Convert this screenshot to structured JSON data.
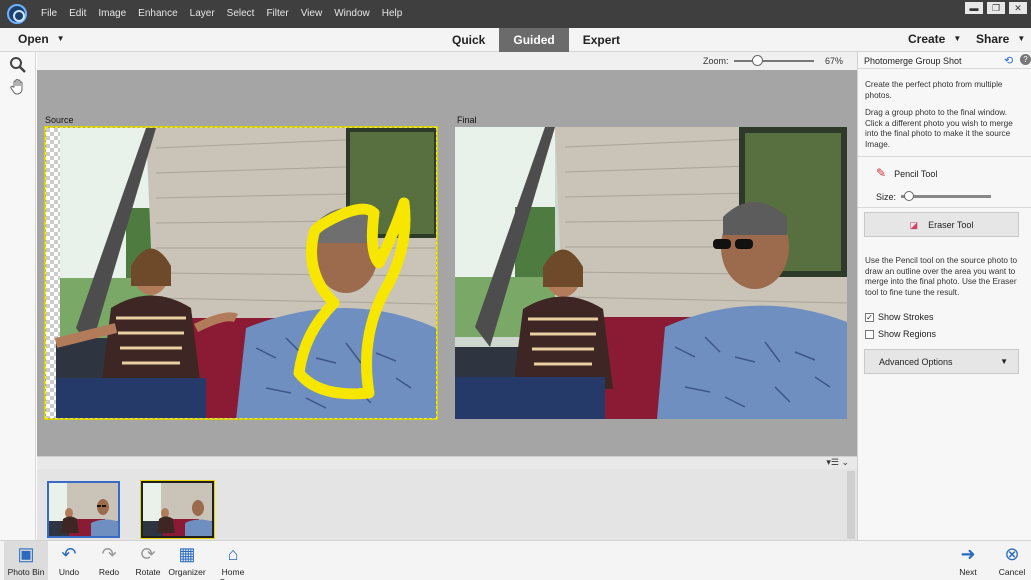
{
  "menu": [
    "File",
    "Edit",
    "Image",
    "Enhance",
    "Layer",
    "Select",
    "Filter",
    "View",
    "Window",
    "Help"
  ],
  "window_controls": {
    "minimize": "▬",
    "restore": "❐",
    "close": "✕"
  },
  "modebar": {
    "open": "Open",
    "tabs": [
      "Quick",
      "Guided",
      "Expert"
    ],
    "active_tab": "Guided",
    "create": "Create",
    "share": "Share"
  },
  "zoom": {
    "label": "Zoom:",
    "value": "67%",
    "level": 0.25
  },
  "workspace": {
    "source_label": "Source",
    "final_label": "Final"
  },
  "panel": {
    "title": "Photomerge Group Shot",
    "intro": "Create the perfect photo from multiple photos.",
    "instructions": "Drag a group photo to the final window. Click a different photo you wish to merge into the final photo to make it the source Image.",
    "pencil_tool": "Pencil Tool",
    "size_label": "Size:",
    "eraser_tool": "Eraser Tool",
    "help_text": "Use the Pencil tool on the source photo to draw an outline over the area you want to merge into the final photo. Use the Eraser tool to fine tune the result.",
    "show_strokes": "Show Strokes",
    "show_strokes_checked": true,
    "show_regions": "Show Regions",
    "show_regions_checked": false,
    "advanced_options": "Advanced Options"
  },
  "bottombar": {
    "left": [
      "Photo Bin",
      "Undo",
      "Redo",
      "Rotate",
      "Organizer",
      "Home Screen"
    ],
    "right": [
      "Next",
      "Cancel"
    ]
  },
  "colors": {
    "accent": "#2a6bbf",
    "stroke": "#f6e600",
    "menubar": "#3f3f3f"
  }
}
